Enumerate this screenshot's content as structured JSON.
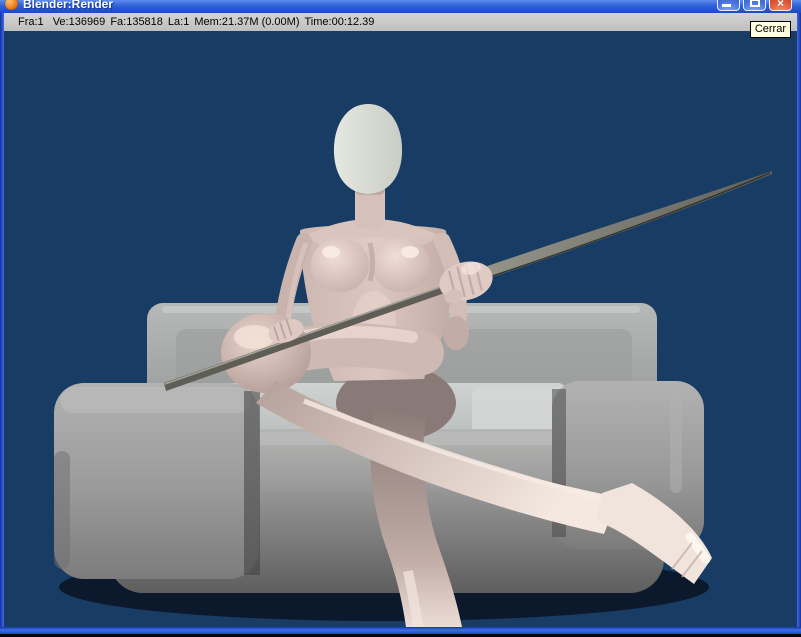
{
  "window": {
    "title": "Blender:Render",
    "controls": [
      {
        "name": "minimize",
        "glyph": "_"
      },
      {
        "name": "maximize",
        "glyph": "□"
      },
      {
        "name": "close",
        "glyph": "×"
      }
    ]
  },
  "stats_bar": {
    "frame": "Fra:1",
    "vertices": "Ve:136969",
    "faces": "Fa:135818",
    "lamps": "La:1",
    "memory": "Mem:21.37M (0.00M)",
    "time": "Time:00:12.39"
  },
  "tooltip": {
    "text": "Cerrar"
  },
  "colors": {
    "titlebar_blue": "#2E61D8",
    "window_border_blue": "#3C6CE8",
    "stats_background": "#C6C6C6",
    "render_background": "#193C64",
    "tooltip_background": "#FFFFE1",
    "close_button_red": "#DE5430",
    "control_button_blue": "#4470DE",
    "couch_gray": "#9C9C9C",
    "figure_skin": "#D8C3BC",
    "head_gray": "#DBDED6",
    "sword_gray": "#6E6E66"
  }
}
